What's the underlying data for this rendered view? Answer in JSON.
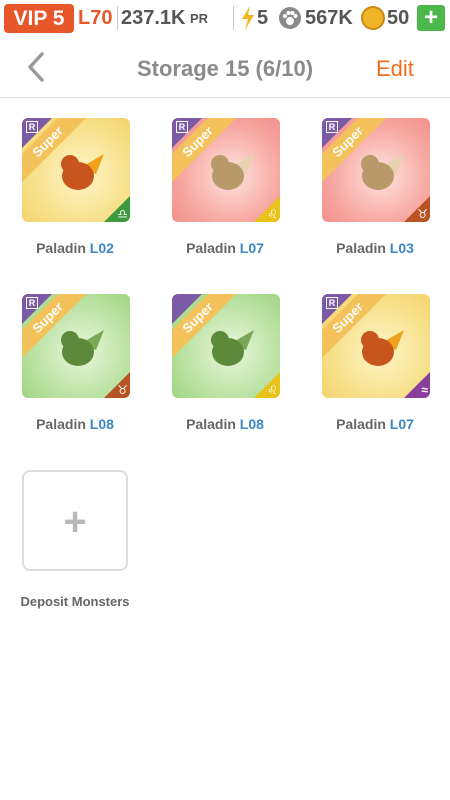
{
  "status": {
    "vip": "VIP 5",
    "level": "L70",
    "power": "237.1K",
    "power_unit": "PR",
    "energy": "5",
    "food": "567K",
    "gems": "50",
    "add_label": "+"
  },
  "nav": {
    "title": "Storage 15 (6/10)",
    "edit_label": "Edit"
  },
  "monsters": [
    {
      "name": "Paladin",
      "level": "L02",
      "rarity_badge": "R",
      "tier": "Super",
      "bg": "gold",
      "element_color": "#3c9a3c",
      "element_glyph": "♎"
    },
    {
      "name": "Paladin",
      "level": "L07",
      "rarity_badge": "R",
      "tier": "Super",
      "bg": "red",
      "element_color": "#e9c21a",
      "element_glyph": "♌"
    },
    {
      "name": "Paladin",
      "level": "L03",
      "rarity_badge": "R",
      "tier": "Super",
      "bg": "red",
      "element_color": "#b85424",
      "element_glyph": "♉"
    },
    {
      "name": "Paladin",
      "level": "L08",
      "rarity_badge": "R",
      "tier": "Super",
      "bg": "green",
      "element_color": "#b85424",
      "element_glyph": "♉"
    },
    {
      "name": "Paladin",
      "level": "L08",
      "rarity_badge": "",
      "tier": "Super",
      "bg": "green",
      "element_color": "#e9c21a",
      "element_glyph": "♌"
    },
    {
      "name": "Paladin",
      "level": "L07",
      "rarity_badge": "R",
      "tier": "Super",
      "bg": "gold",
      "element_color": "#8a3f9e",
      "element_glyph": "≈"
    }
  ],
  "deposit": {
    "plus": "+",
    "label": "Deposit Monsters"
  }
}
